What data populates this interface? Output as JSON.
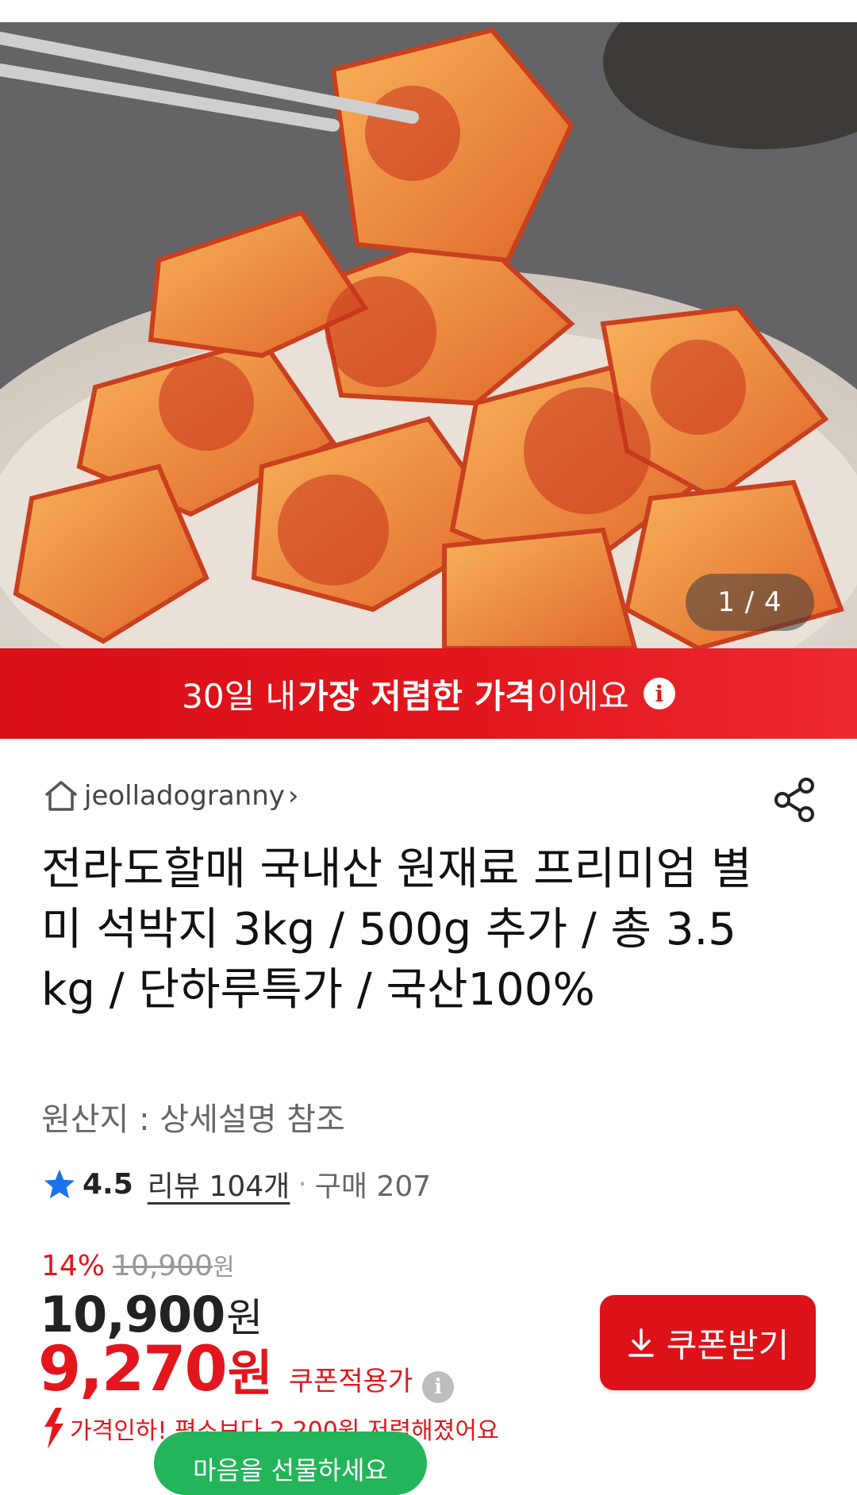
{
  "hero": {
    "image_desc_icon": "kimchi-photo",
    "counter": "1 / 4"
  },
  "banner": {
    "prefix": "30일 내 ",
    "highlight": "가장 저렴한 가격",
    "suffix": "이에요",
    "info_icon": "i"
  },
  "store": {
    "name": "jeolladogranny",
    "chevron": "›"
  },
  "product": {
    "title": "전라도할매 국내산 원재료 프리미엄 별미 석박지 3kg / 500g 추가 / 총 3.5kg / 단하루특가 / 국산100%",
    "origin": "원산지 : 상세설명 참조"
  },
  "rating": {
    "score": "4.5",
    "reviews": "리뷰 104개",
    "dot": "·",
    "sold": "구매 207"
  },
  "price": {
    "discount_pct": "14%",
    "original": "10,900",
    "original_unit": "원",
    "sale": "10,900",
    "sale_unit": "원",
    "coupon_price": "9,270",
    "coupon_unit": "원",
    "coupon_label": "쿠폰적용가",
    "info_icon": "i"
  },
  "coupon_button": {
    "label": "쿠폰받기"
  },
  "price_drop": {
    "text": "가격인하! 평소보다 2,200원 저렴해졌어요"
  },
  "gift": {
    "label": "마음을 선물하세요"
  },
  "colors": {
    "accent": "#e3161d",
    "green": "#23b55a"
  }
}
